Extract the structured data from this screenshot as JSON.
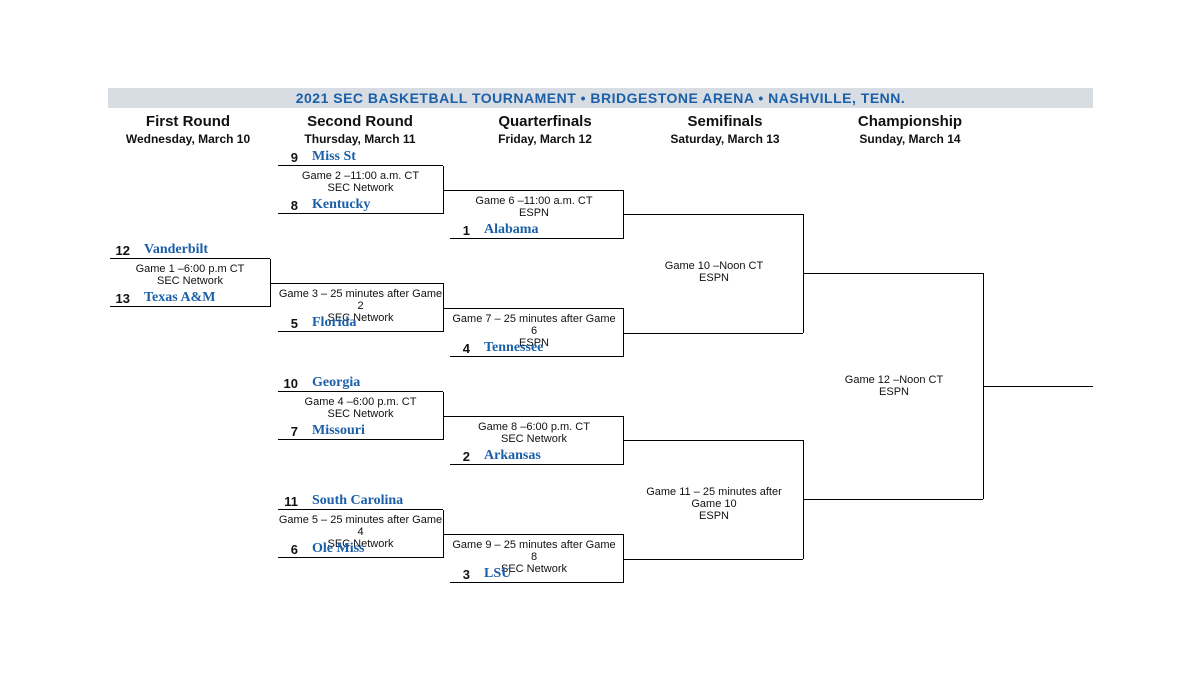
{
  "title": "2021 SEC BASKETBALL TOURNAMENT • BRIDGESTONE ARENA • NASHVILLE, TENN.",
  "rounds": {
    "r1": {
      "name": "First Round",
      "date": "Wednesday, March 10"
    },
    "r2": {
      "name": "Second Round",
      "date": "Thursday, March 11"
    },
    "r3": {
      "name": "Quarterfinals",
      "date": "Friday, March 12"
    },
    "r4": {
      "name": "Semifinals",
      "date": "Saturday, March 13"
    },
    "r5": {
      "name": "Championship",
      "date": "Sunday, March 14"
    }
  },
  "teams": {
    "s12": {
      "seed": "12",
      "name": "Vanderbilt"
    },
    "s13": {
      "seed": "13",
      "name": "Texas A&M"
    },
    "s9": {
      "seed": "9",
      "name": "Miss St"
    },
    "s8": {
      "seed": "8",
      "name": "Kentucky"
    },
    "s5": {
      "seed": "5",
      "name": "Florida"
    },
    "s10": {
      "seed": "10",
      "name": "Georgia"
    },
    "s7": {
      "seed": "7",
      "name": "Missouri"
    },
    "s11": {
      "seed": "11",
      "name": "South Carolina"
    },
    "s6": {
      "seed": "6",
      "name": "Ole Miss"
    },
    "s1": {
      "seed": "1",
      "name": "Alabama"
    },
    "s4": {
      "seed": "4",
      "name": "Tennessee"
    },
    "s2": {
      "seed": "2",
      "name": "Arkansas"
    },
    "s3": {
      "seed": "3",
      "name": "LSU"
    }
  },
  "games": {
    "g1": {
      "l1": "Game 1 –6:00 p.m CT",
      "l2": "SEC Network"
    },
    "g2": {
      "l1": "Game 2 –11:00 a.m. CT",
      "l2": "SEC Network"
    },
    "g3": {
      "l1": "Game 3 – 25 minutes after Game 2",
      "l2": "SEC Network"
    },
    "g4": {
      "l1": "Game 4 –6:00 p.m. CT",
      "l2": "SEC Network"
    },
    "g5": {
      "l1": "Game 5 – 25 minutes after Game 4",
      "l2": "SEC Network"
    },
    "g6": {
      "l1": "Game 6 –11:00 a.m. CT",
      "l2": "ESPN"
    },
    "g7": {
      "l1": "Game 7 – 25 minutes after Game 6",
      "l2": "ESPN"
    },
    "g8": {
      "l1": "Game 8 –6:00 p.m. CT",
      "l2": "SEC Network"
    },
    "g9": {
      "l1": "Game 9 – 25 minutes after Game 8",
      "l2": "SEC Network"
    },
    "g10": {
      "l1": "Game 10 –Noon CT",
      "l2": "ESPN"
    },
    "g11": {
      "l1": "Game 11 – 25 minutes after Game 10",
      "l2": "ESPN"
    },
    "g12": {
      "l1": "Game 12 –Noon CT",
      "l2": "ESPN"
    }
  }
}
